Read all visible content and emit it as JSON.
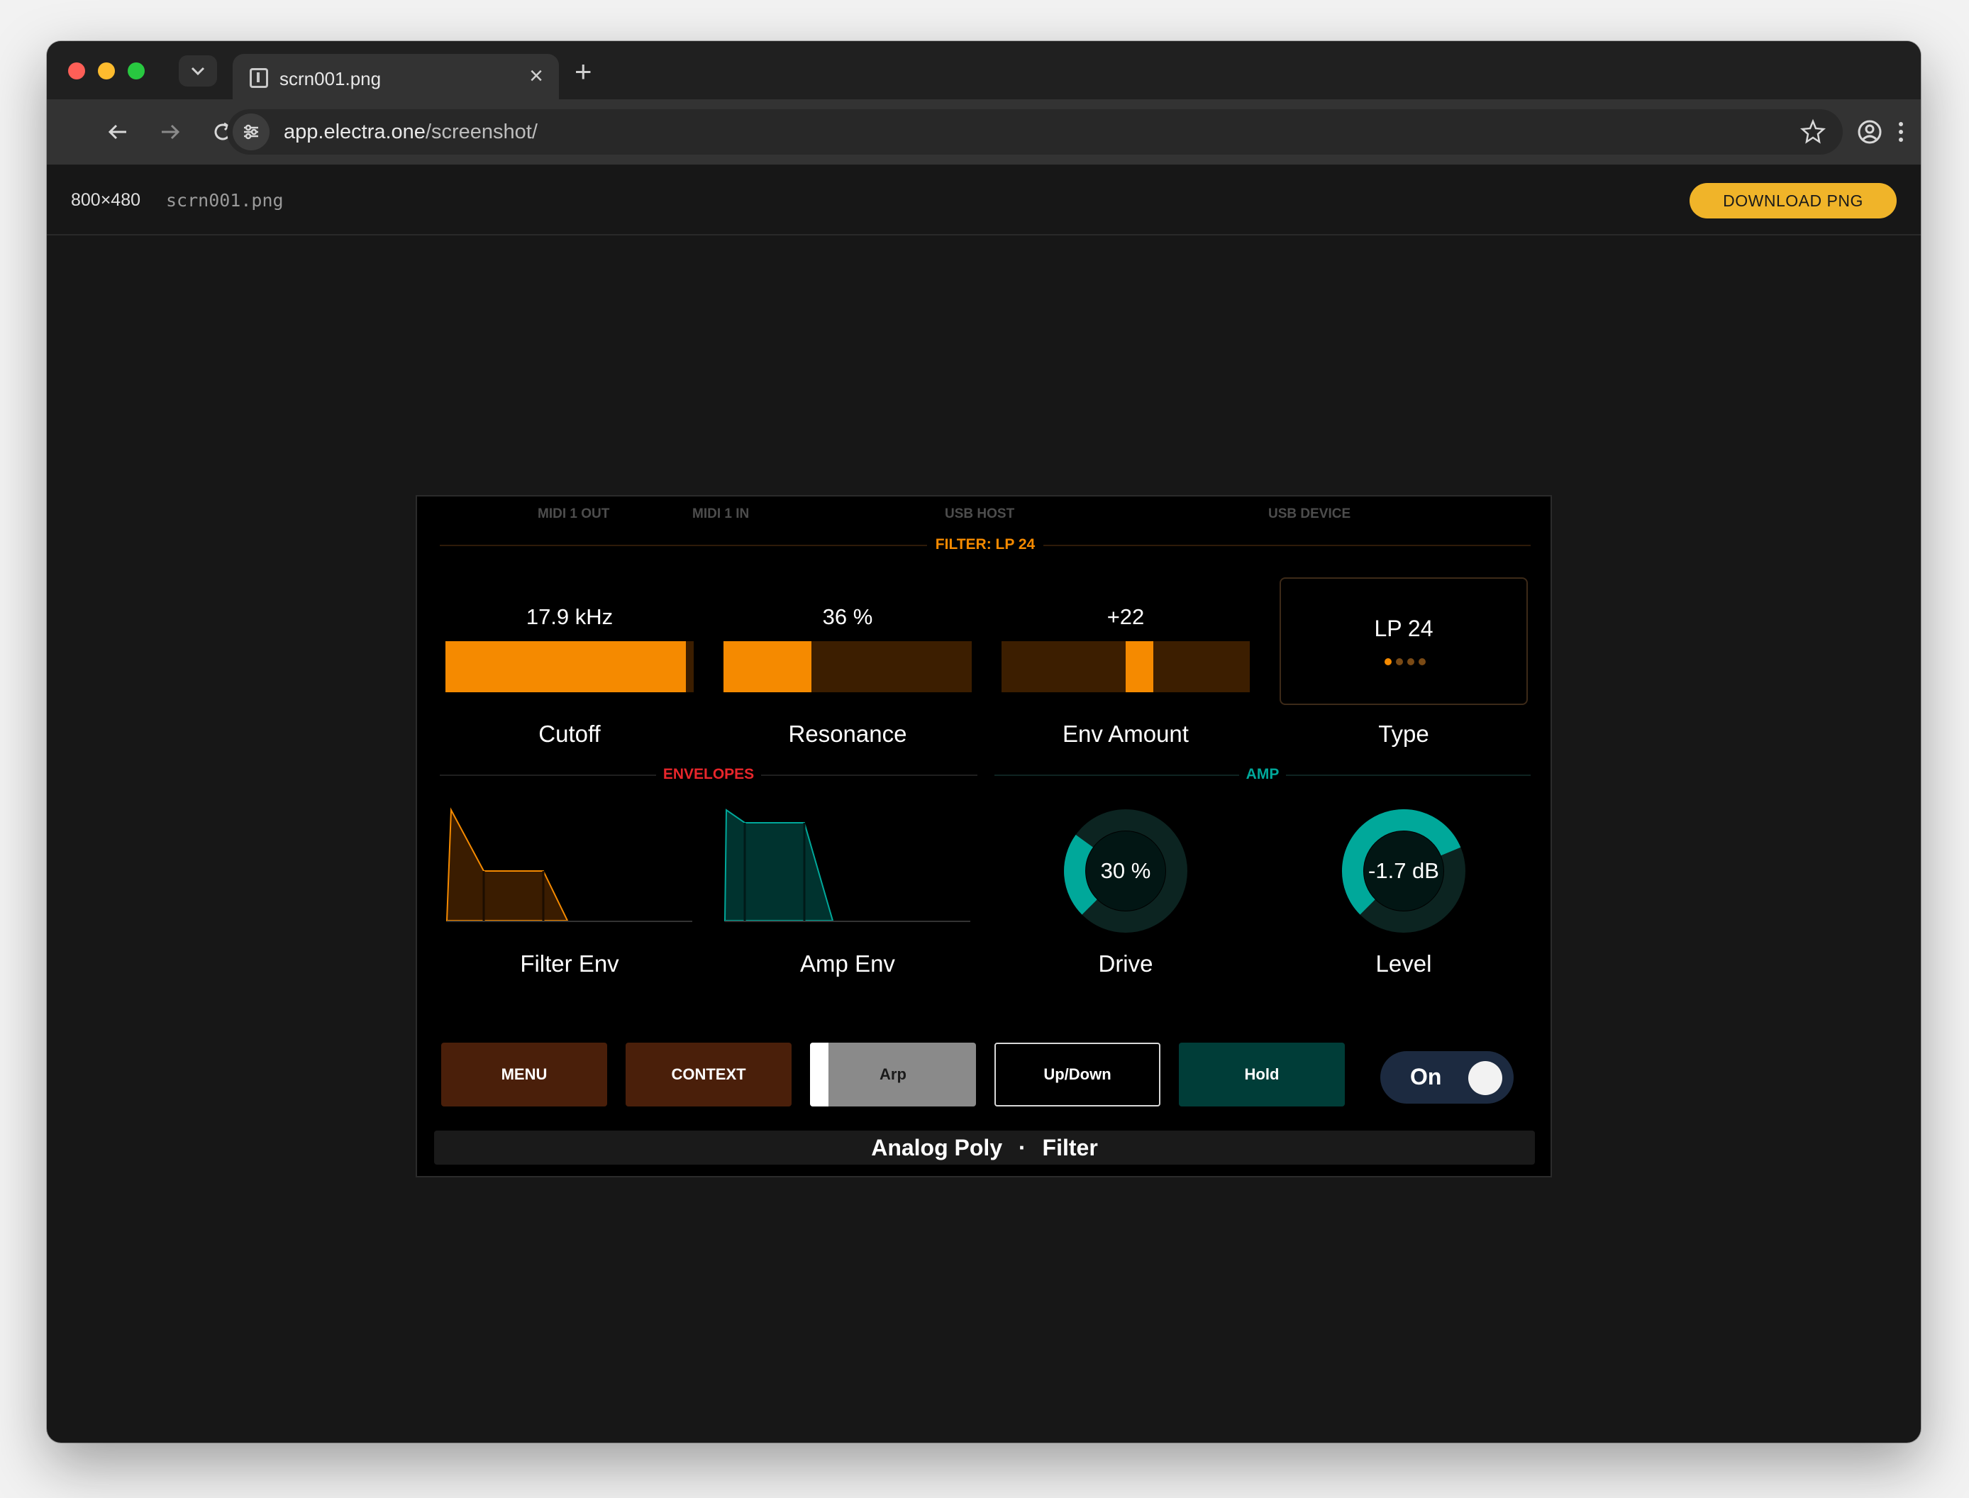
{
  "browser": {
    "tab_title": "scrn001.png",
    "url_host": "app.electra.one",
    "url_path": "/screenshot/"
  },
  "infobar": {
    "dimensions": "800×480",
    "filename": "scrn001.png",
    "download_label": "DOWNLOAD PNG"
  },
  "device": {
    "status": {
      "midi1_out": "MIDI 1 OUT",
      "midi1_in": "MIDI 1 IN",
      "usb_host": "USB HOST",
      "usb_device": "USB DEVICE"
    },
    "filter_section": {
      "title": "FILTER: LP 24",
      "color": "#f58a00",
      "controls": [
        {
          "label": "Cutoff",
          "value": "17.9 kHz",
          "level": 0.99
        },
        {
          "label": "Resonance",
          "value": "36 %",
          "level": 0.36
        },
        {
          "label": "Env Amount",
          "value": "+22",
          "bipolar_level": 0.22
        }
      ],
      "type": {
        "label": "Type",
        "value": "LP 24",
        "option_count": 4,
        "selected_option": 1
      }
    },
    "envelopes_section": {
      "title": "ENVELOPES",
      "color": "#e8262b",
      "filter_env": {
        "label": "Filter Env",
        "color": "#f58a00"
      },
      "amp_env": {
        "label": "Amp Env",
        "color": "#00a89a"
      }
    },
    "amp_section": {
      "title": "AMP",
      "color": "#00a89a",
      "drive": {
        "label": "Drive",
        "value": "30 %",
        "level": 0.3
      },
      "level": {
        "label": "Level",
        "value": "-1.7 dB",
        "level": 0.75
      }
    },
    "pads": {
      "menu": "MENU",
      "context": "CONTEXT",
      "arp": "Arp",
      "updown": "Up/Down",
      "hold": "Hold"
    },
    "toggle": {
      "label": "On",
      "state": true
    },
    "footer": {
      "preset": "Analog Poly",
      "separator": "·",
      "page": "Filter"
    }
  }
}
